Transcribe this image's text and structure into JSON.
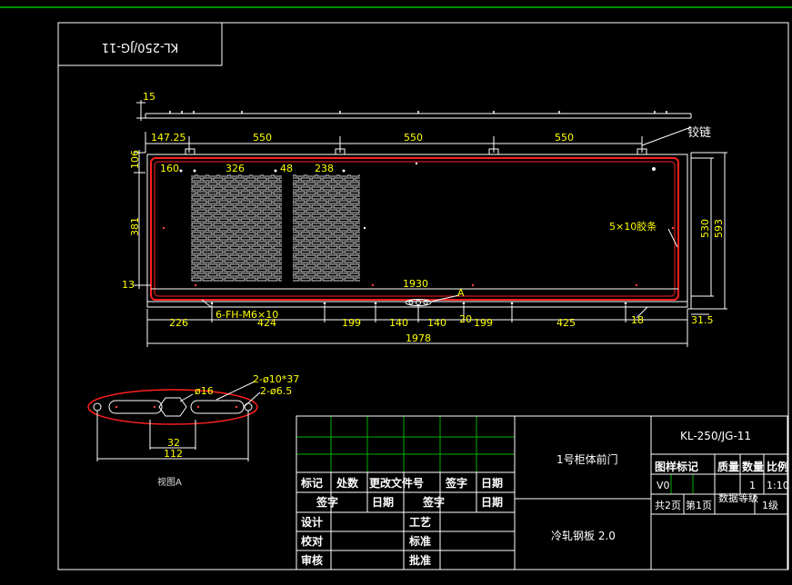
{
  "colors": {
    "background": "#000000",
    "frame": "#ffffff",
    "top_rule": "#00c000",
    "gasket": "#ff2020",
    "dimension_text": "#ffff00",
    "title_grid": "#00b000"
  },
  "stamp": {
    "text": "KL-250/JG-11"
  },
  "top_view": {
    "thickness": "15"
  },
  "front_view": {
    "hinge_dims": [
      "147.25",
      "550",
      "550",
      "550"
    ],
    "hinge_label": "铰链",
    "left_dims": {
      "top": "106",
      "mid": "381",
      "bottom": "13"
    },
    "inner_dims": {
      "a": "160",
      "b": "326",
      "c": "48",
      "d": "238"
    },
    "width_inner": "1930",
    "detail_marker": "A",
    "screw_label": "6-FH-M6×10",
    "gasket_label": "5×10胶条",
    "right_dims": {
      "inner": "530",
      "outer": "593"
    },
    "bottom_dims": [
      "226",
      "424",
      "199",
      "140",
      "140",
      "20",
      "199",
      "425",
      "18"
    ],
    "right_bottom": "31.5",
    "overall_width": "1978"
  },
  "view_a": {
    "title": "视图A",
    "slot_label": "2-ø10*37",
    "hole_label": "2-ø6.5",
    "center_hole": "ø16",
    "dim_inner": "32",
    "dim_outer": "112"
  },
  "title_block": {
    "header_row1": [
      "标记",
      "处数",
      "更改文件号",
      "签字",
      "日期"
    ],
    "header_row2": [
      "签字",
      "日期",
      "签字",
      "日期"
    ],
    "design": "设计",
    "process": "工艺",
    "check": "校对",
    "standard": "标准",
    "review": "审核",
    "approve": "批准",
    "part_name": "1号柜体前门",
    "material": "冷轧钢板 2.0",
    "drawing_no": "KL-250/JG-11",
    "col_headers": [
      "图样标记",
      "质量",
      "数量",
      "比例"
    ],
    "version": "V0",
    "quantity": "1",
    "scale": "1:10",
    "sheets_total": "共2页",
    "sheet_no": "第1页",
    "data_level_label": "数据等级",
    "data_level": "1级"
  }
}
